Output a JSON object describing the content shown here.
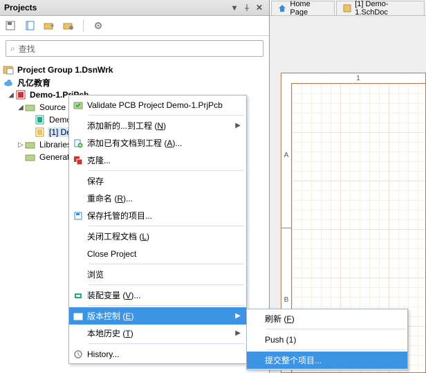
{
  "panel": {
    "title": "Projects"
  },
  "search": {
    "placeholder": "查找"
  },
  "tree": {
    "root": "Project Group 1.DsnWrk",
    "edu": "凡亿教育",
    "project": "Demo-1.PrjPcb",
    "source": "Source D",
    "demo_doc": "Demo",
    "sch_doc": "[1] De",
    "libraries": "Libraries",
    "generate": "Generat"
  },
  "tabs": {
    "home": "Home Page",
    "doc": "[1] Demo-1.SchDoc"
  },
  "ruler": {
    "col1": "1",
    "rowA": "A",
    "rowB": "B"
  },
  "menu": {
    "validate": "Validate PCB Project Demo-1.PrjPcb",
    "add_new": "添加新的...到工程 (N)",
    "add_existing": "添加已有文档到工程 (A)...",
    "clone": "克隆...",
    "save": "保存",
    "rename": "重命名 (R)...",
    "save_managed": "保存托管的项目...",
    "close_docs": "关闭工程文档 (L)",
    "close_project": "Close Project",
    "browse": "浏览",
    "assembly": "装配变量 (V)...",
    "version_control": "版本控制 (E)",
    "local_history": "本地历史 (T)",
    "history": "History..."
  },
  "submenu": {
    "refresh": "刷新 (F)",
    "push": "Push (1)",
    "commit": "提交整个项目..."
  }
}
